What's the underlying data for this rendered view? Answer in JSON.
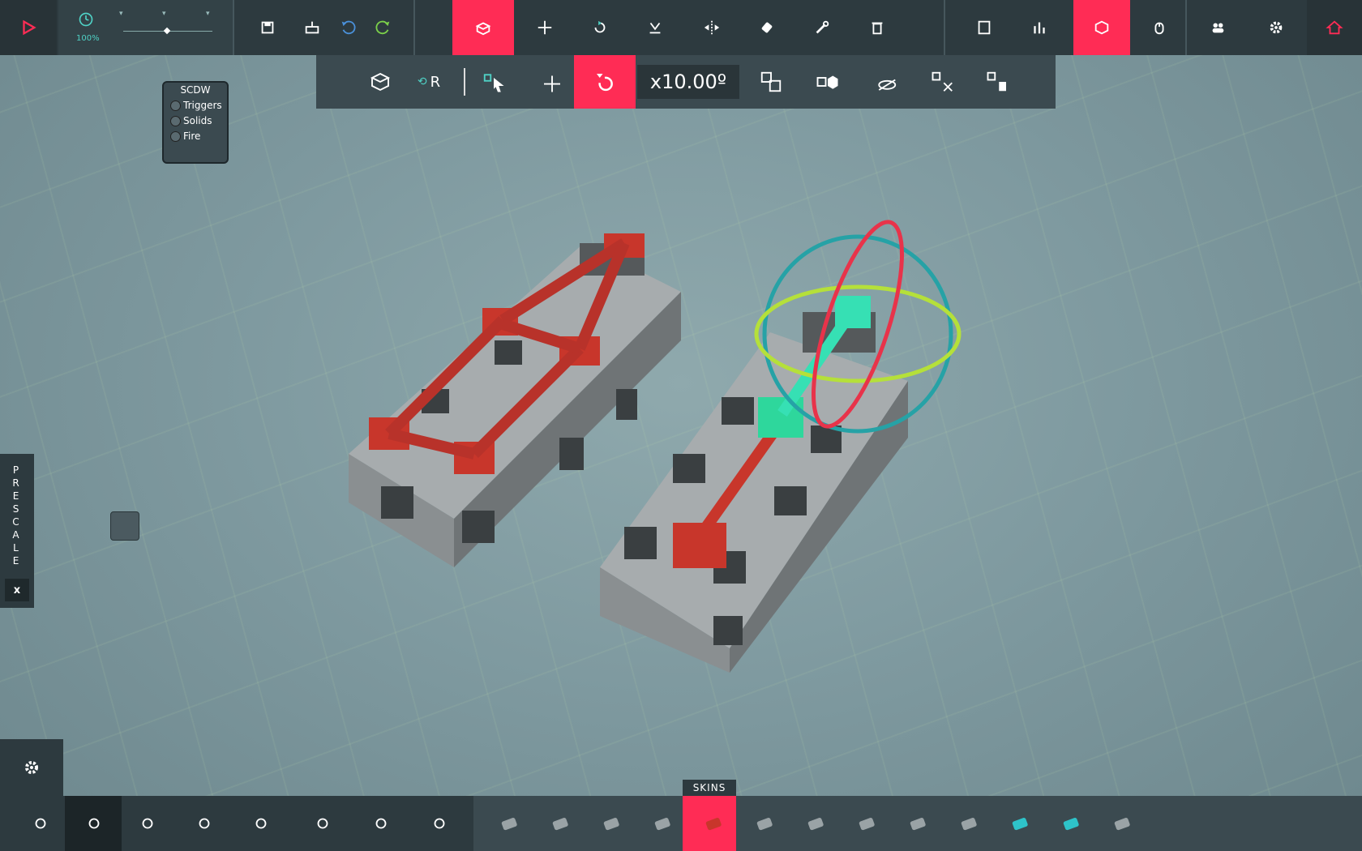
{
  "top_bar": {
    "play_icon": "play-icon",
    "speed_value": "100%",
    "tools": [
      {
        "name": "save-icon"
      },
      {
        "name": "load-icon"
      },
      {
        "name": "undo-icon"
      },
      {
        "name": "redo-icon"
      },
      {
        "name": "build-tool-icon",
        "active": true
      },
      {
        "name": "translate-icon"
      },
      {
        "name": "rotate-icon"
      },
      {
        "name": "snap-ground-icon"
      },
      {
        "name": "mirror-icon"
      },
      {
        "name": "eraser-icon"
      },
      {
        "name": "wrench-icon"
      },
      {
        "name": "delete-icon"
      },
      {
        "name": "single-view-icon"
      },
      {
        "name": "stats-icon"
      },
      {
        "name": "block-view-icon",
        "active": true
      },
      {
        "name": "mouse-icon"
      },
      {
        "name": "multiplayer-icon"
      },
      {
        "name": "settings-gear-icon"
      },
      {
        "name": "home-icon"
      }
    ]
  },
  "sub_bar": {
    "reset_label": "R",
    "angle_value": "x10.00º"
  },
  "scdw_panel": {
    "title": "SCDW",
    "options": [
      "Triggers",
      "Solids",
      "Fire"
    ]
  },
  "prescale": {
    "label": "PRESCALE",
    "close_label": "x"
  },
  "bottom_bar": {
    "skins_label": "SKINS",
    "categories": [
      "gear-settings-icon",
      "record-icon",
      "cube-icon",
      "wheel-icon",
      "hand-icon",
      "sword-icon",
      "propeller-icon",
      "shield-icon",
      "magnifier-icon"
    ],
    "blocks": [
      "small-block-icon",
      "double-block-icon",
      "long-block-icon",
      "brace-icon",
      "red-bar-icon",
      "hammer-block-icon",
      "spike-icon",
      "turret-icon",
      "plank-icon",
      "grid-block-icon",
      "pin-icon",
      "balloon-icon",
      "anchor-icon"
    ]
  },
  "colors": {
    "accent": "#ff2c55",
    "bar": "#2d3a3f",
    "teal": "#4fd1c5"
  }
}
